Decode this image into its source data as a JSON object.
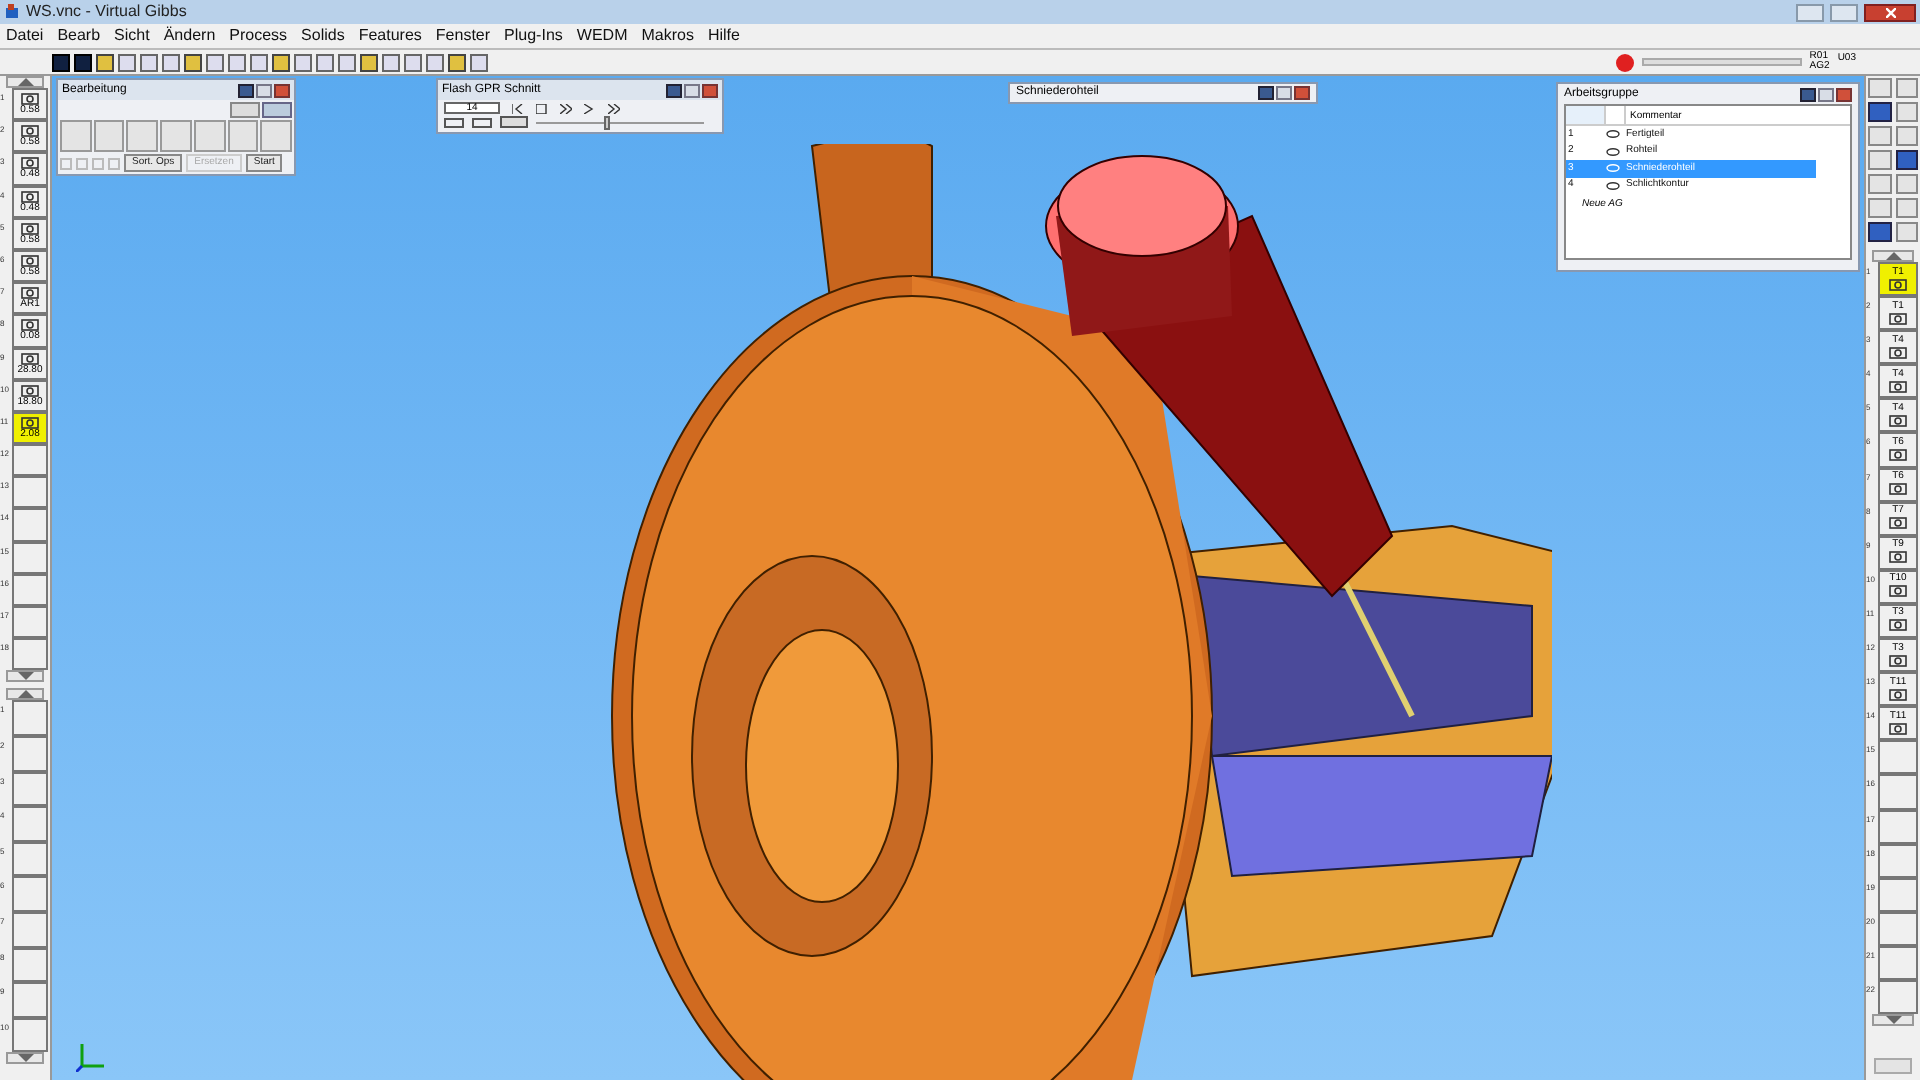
{
  "window": {
    "title": "WS.vnc - Virtual Gibbs"
  },
  "menu": [
    "Datei",
    "Bearb",
    "Sicht",
    "Ändern",
    "Process",
    "Solids",
    "Features",
    "Fenster",
    "Plug-Ins",
    "WEDM",
    "Makros",
    "Hilfe"
  ],
  "status": {
    "labels": [
      "R01",
      "AG2",
      "U03"
    ],
    "level": 0
  },
  "left_tools": [
    {
      "number": "1",
      "value": "0.58",
      "selected": false
    },
    {
      "number": "2",
      "value": "0.58",
      "selected": false
    },
    {
      "number": "3",
      "value": "0.48",
      "selected": false
    },
    {
      "number": "4",
      "value": "0.48",
      "selected": false
    },
    {
      "number": "5",
      "value": "0.58",
      "selected": false
    },
    {
      "number": "6",
      "value": "0.58",
      "selected": false
    },
    {
      "number": "7",
      "value": "AR1",
      "selected": false
    },
    {
      "number": "8",
      "value": "0.08",
      "selected": false
    },
    {
      "number": "9",
      "value": "28.80",
      "selected": false
    },
    {
      "number": "10",
      "value": "18.80",
      "selected": false
    },
    {
      "number": "11",
      "value": "2.08",
      "selected": true
    },
    {
      "number": "12",
      "selected": false
    },
    {
      "number": "13",
      "selected": false
    },
    {
      "number": "14",
      "selected": false
    },
    {
      "number": "15",
      "selected": false
    },
    {
      "number": "16",
      "selected": false
    },
    {
      "number": "17",
      "selected": false
    },
    {
      "number": "18",
      "selected": false
    }
  ],
  "left_tools_2": [
    {
      "number": "1"
    },
    {
      "number": "2"
    },
    {
      "number": "3"
    },
    {
      "number": "4"
    },
    {
      "number": "5"
    },
    {
      "number": "6"
    },
    {
      "number": "7"
    },
    {
      "number": "8"
    },
    {
      "number": "9"
    },
    {
      "number": "10"
    }
  ],
  "right_tools": [
    {
      "number": "1",
      "label": "T1",
      "selected": true
    },
    {
      "number": "2",
      "label": "T1",
      "selected": false
    },
    {
      "number": "3",
      "label": "T4",
      "selected": false
    },
    {
      "number": "4",
      "label": "T4",
      "selected": false
    },
    {
      "number": "5",
      "label": "T4",
      "selected": false
    },
    {
      "number": "6",
      "label": "T6",
      "selected": false
    },
    {
      "number": "7",
      "label": "T6",
      "selected": false
    },
    {
      "number": "8",
      "label": "T7",
      "selected": false
    },
    {
      "number": "9",
      "label": "T9",
      "selected": false
    },
    {
      "number": "10",
      "label": "T10",
      "selected": false
    },
    {
      "number": "11",
      "label": "T3",
      "selected": false
    },
    {
      "number": "12",
      "label": "T3",
      "selected": false
    },
    {
      "number": "13",
      "label": "T11",
      "selected": false
    },
    {
      "number": "14",
      "label": "T11",
      "selected": false
    },
    {
      "number": "15",
      "selected": false
    },
    {
      "number": "16",
      "selected": false
    },
    {
      "number": "17",
      "selected": false
    },
    {
      "number": "18",
      "selected": false
    },
    {
      "number": "19",
      "selected": false
    },
    {
      "number": "20",
      "selected": false
    },
    {
      "number": "21",
      "selected": false
    },
    {
      "number": "22",
      "selected": false
    }
  ],
  "bearbeitung": {
    "title": "Bearbeitung",
    "buttons": [
      {
        "label": "Sort. Ops",
        "disabled": false
      },
      {
        "label": "Ersetzen",
        "disabled": true
      },
      {
        "label": "Start",
        "disabled": false
      }
    ]
  },
  "flash": {
    "title": "Flash GPR Schnitt",
    "field": "14",
    "level": 0.4
  },
  "schmiede": {
    "title": "Schniederohteil"
  },
  "arbeitsgruppe": {
    "title": "Arbeitsgruppe",
    "column": "Kommentar",
    "rows": [
      {
        "number": "1",
        "name": "Fertigteil",
        "selected": false
      },
      {
        "number": "2",
        "name": "Rohteil",
        "selected": false
      },
      {
        "number": "3",
        "name": "Schniederohteil",
        "selected": true
      },
      {
        "number": "4",
        "name": "Schlichtkontur",
        "selected": false
      }
    ],
    "new_item": "Neue AG"
  }
}
